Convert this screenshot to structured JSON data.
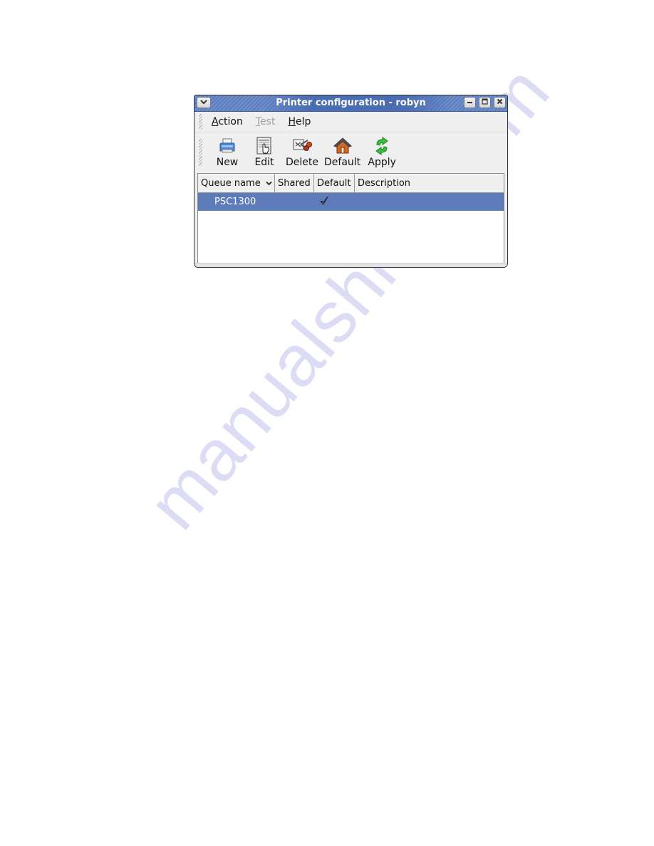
{
  "watermark": "manualshive.com",
  "window": {
    "title": "Printer configuration - robyn",
    "controls": {
      "menu_icon": "chevron-down-icon",
      "minimize_icon": "minimize-icon",
      "maximize_icon": "maximize-icon",
      "close_icon": "close-icon"
    }
  },
  "menubar": {
    "items": [
      {
        "label": "Action",
        "mnemonic": "A",
        "rest": "ction",
        "enabled": true
      },
      {
        "label": "Test",
        "mnemonic": "T",
        "rest": "est",
        "enabled": false
      },
      {
        "label": "Help",
        "mnemonic": "H",
        "rest": "elp",
        "enabled": true
      }
    ]
  },
  "toolbar": {
    "buttons": [
      {
        "label": "New",
        "icon": "printer-icon"
      },
      {
        "label": "Edit",
        "icon": "edit-document-icon"
      },
      {
        "label": "Delete",
        "icon": "scissors-delete-icon"
      },
      {
        "label": "Default",
        "icon": "home-icon"
      },
      {
        "label": "Apply",
        "icon": "refresh-arrows-icon"
      }
    ]
  },
  "table": {
    "columns": [
      {
        "label": "Queue name",
        "sorted": true,
        "sort_indicator": "⌄"
      },
      {
        "label": "Shared"
      },
      {
        "label": "Default"
      },
      {
        "label": "Description"
      }
    ],
    "rows": [
      {
        "queue_name": "PSC1300",
        "shared": false,
        "default": true,
        "default_mark": "✓",
        "description": "",
        "selected": true
      }
    ]
  },
  "colors": {
    "titlebar": "#5b7bbf",
    "selection": "#5e7bb9",
    "window_bg": "#efefef",
    "watermark": "#d9d9f5"
  }
}
